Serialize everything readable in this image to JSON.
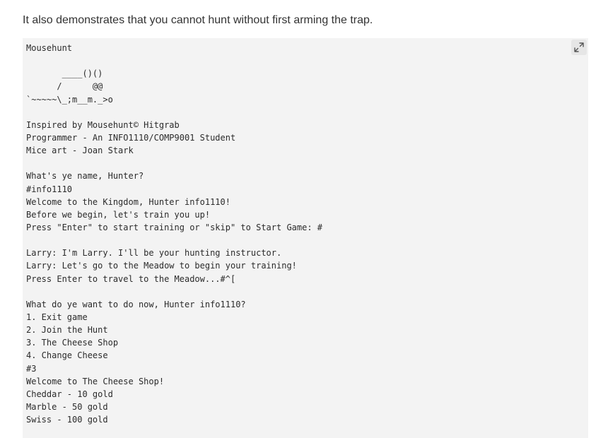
{
  "intro_text": "It also demonstrates that you cannot hunt without first arming the trap.",
  "code_lines": [
    "Mousehunt",
    "",
    "       ____()()",
    "      /      @@",
    "`~~~~~\\_;m__m._>o",
    "",
    "Inspired by Mousehunt© Hitgrab",
    "Programmer - An INFO1110/COMP9001 Student",
    "Mice art - Joan Stark",
    "",
    "What's ye name, Hunter?",
    "#info1110",
    "Welcome to the Kingdom, Hunter info1110!",
    "Before we begin, let's train you up!",
    "Press \"Enter\" to start training or \"skip\" to Start Game: #",
    "",
    "Larry: I'm Larry. I'll be your hunting instructor.",
    "Larry: Let's go to the Meadow to begin your training!",
    "Press Enter to travel to the Meadow...#^[",
    "",
    "What do ye want to do now, Hunter info1110?",
    "1. Exit game",
    "2. Join the Hunt",
    "3. The Cheese Shop",
    "4. Change Cheese",
    "#3",
    "Welcome to The Cheese Shop!",
    "Cheddar - 10 gold",
    "Marble - 50 gold",
    "Swiss - 100 gold"
  ],
  "expand_button_icon": "expand-icon",
  "colors": {
    "code_background": "#f3f3f3",
    "text": "#333333"
  }
}
